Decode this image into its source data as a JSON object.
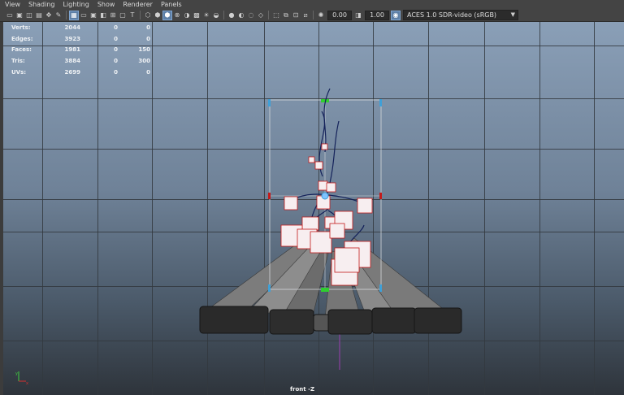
{
  "menu": [
    "View",
    "Shading",
    "Lighting",
    "Show",
    "Renderer",
    "Panels"
  ],
  "toolbar": {
    "exposure": "0.00",
    "gamma": "1.00",
    "color_space": "ACES 1.0 SDR-video (sRGB)"
  },
  "hud": {
    "rows": [
      {
        "label": "Verts:",
        "v1": "2044",
        "v2": "0",
        "v3": "0"
      },
      {
        "label": "Edges:",
        "v1": "3923",
        "v2": "0",
        "v3": "0"
      },
      {
        "label": "Faces:",
        "v1": "1981",
        "v2": "0",
        "v3": "150"
      },
      {
        "label": "Tris:",
        "v1": "3884",
        "v2": "0",
        "v3": "300"
      },
      {
        "label": "UVs:",
        "v1": "2699",
        "v2": "0",
        "v3": "0"
      }
    ]
  },
  "viewport": {
    "camera_label": "front -Z",
    "axis": {
      "x": "x",
      "y": "y"
    }
  },
  "colors": {
    "selection": "#c41a1a",
    "bbox_handle": "#3fa0d8",
    "pivot": "#2fcf2f",
    "leaf_fill": "#f7eef0"
  }
}
